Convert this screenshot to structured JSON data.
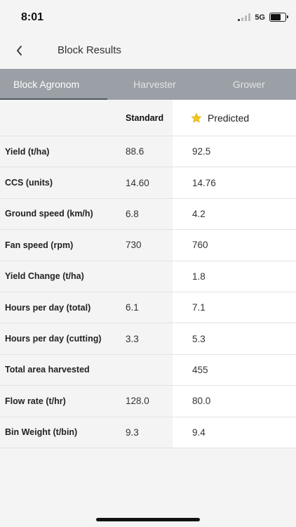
{
  "status_bar": {
    "time": "8:01",
    "network": "5G"
  },
  "header": {
    "title": "Block Results"
  },
  "tabs": [
    {
      "label": "Block Agronom",
      "active": true
    },
    {
      "label": "Harvester",
      "active": false
    },
    {
      "label": "Grower",
      "active": false
    }
  ],
  "table": {
    "columns": {
      "standard": "Standard",
      "predicted": "Predicted"
    },
    "rows": [
      {
        "label": "Yield (t/ha)",
        "standard": "88.6",
        "predicted": "92.5"
      },
      {
        "label": "CCS (units)",
        "standard": "14.60",
        "predicted": "14.76"
      },
      {
        "label": "Ground speed (km/h)",
        "standard": "6.8",
        "predicted": "4.2"
      },
      {
        "label": "Fan speed (rpm)",
        "standard": "730",
        "predicted": "760"
      },
      {
        "label": "Yield Change (t/ha)",
        "standard": "",
        "predicted": "1.8"
      },
      {
        "label": "Hours per day (total)",
        "standard": "6.1",
        "predicted": "7.1"
      },
      {
        "label": "Hours per day (cutting)",
        "standard": "3.3",
        "predicted": "5.3"
      },
      {
        "label": "Total area harvested",
        "standard": "",
        "predicted": "455"
      },
      {
        "label": "Flow rate (t/hr)",
        "standard": "128.0",
        "predicted": "80.0"
      },
      {
        "label": "Bin Weight (t/bin)",
        "standard": "9.3",
        "predicted": "9.4"
      }
    ]
  },
  "colors": {
    "tab_bar": "#9aa0a6",
    "star": "#f5c518",
    "predicted_bg": "#ffffff",
    "page_bg": "#f4f4f4"
  },
  "icons": {
    "back": "chevron-left-icon",
    "predicted": "star-icon"
  }
}
